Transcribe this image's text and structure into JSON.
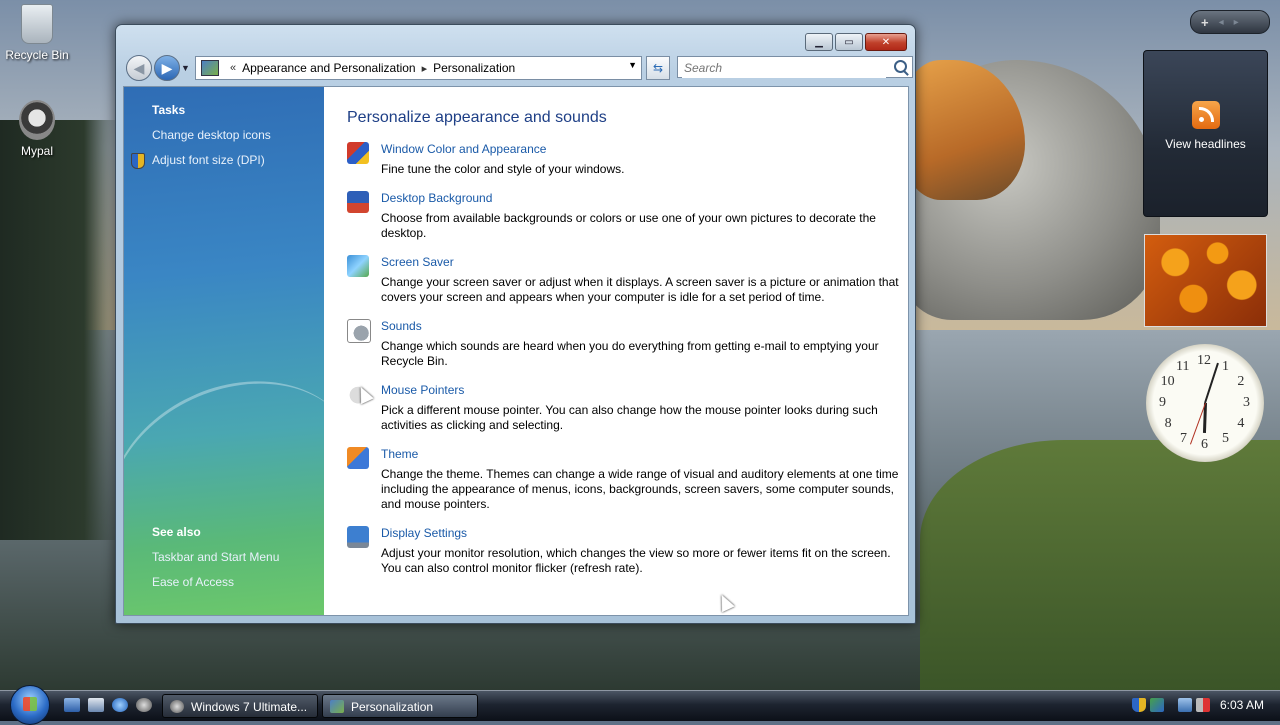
{
  "desktop": {
    "icons": [
      {
        "label": "Recycle Bin",
        "icon": "recycle-bin-icon"
      },
      {
        "label": "Mypal",
        "icon": "mypal-icon"
      }
    ]
  },
  "window": {
    "breadcrumb": {
      "chevron": "«",
      "crumbs": [
        "Appearance and Personalization",
        "Personalization"
      ],
      "separator": "▸"
    },
    "search": {
      "placeholder": "Search"
    },
    "sidebar": {
      "tasks_heading": "Tasks",
      "tasks": [
        "Change desktop icons",
        "Adjust font size (DPI)"
      ],
      "see_also_heading": "See also",
      "see_also": [
        "Taskbar and Start Menu",
        "Ease of Access"
      ]
    },
    "main": {
      "title": "Personalize appearance and sounds",
      "items": [
        {
          "link": "Window Color and Appearance",
          "icon": "window-color-icon",
          "desc": "Fine tune the color and style of your windows."
        },
        {
          "link": "Desktop Background",
          "icon": "desktop-background-icon",
          "desc": "Choose from available backgrounds or colors or use one of your own pictures to decorate the desktop."
        },
        {
          "link": "Screen Saver",
          "icon": "screen-saver-icon",
          "desc": "Change your screen saver or adjust when it displays. A screen saver is a picture or animation that covers your screen and appears when your computer is idle for a set period of time."
        },
        {
          "link": "Sounds",
          "icon": "sounds-icon",
          "desc": "Change which sounds are heard when you do everything from getting e-mail to emptying your Recycle Bin."
        },
        {
          "link": "Mouse Pointers",
          "icon": "mouse-pointer-icon",
          "desc": "Pick a different mouse pointer. You can also change how the mouse pointer looks during such activities as clicking and selecting."
        },
        {
          "link": "Theme",
          "icon": "theme-icon",
          "desc": "Change the theme. Themes can change a wide range of visual and auditory elements at one time including the appearance of menus, icons, backgrounds, screen savers, some computer sounds, and mouse pointers."
        },
        {
          "link": "Display Settings",
          "icon": "display-settings-icon",
          "desc": "Adjust your monitor resolution, which changes the view so more or fewer items fit on the screen. You can also control monitor flicker (refresh rate)."
        }
      ]
    }
  },
  "gadgets": {
    "rail": {
      "add": "+",
      "prev": "◂",
      "next": "▸"
    },
    "feed": {
      "label": "View headlines"
    },
    "clock": {
      "numbers": [
        "12",
        "1",
        "2",
        "3",
        "4",
        "5",
        "6",
        "7",
        "8",
        "9",
        "10",
        "11"
      ]
    }
  },
  "taskbar": {
    "tasks": [
      {
        "label": "Windows 7 Ultimate...",
        "active": false
      },
      {
        "label": "Personalization",
        "active": true
      }
    ],
    "time": "6:03 AM"
  }
}
